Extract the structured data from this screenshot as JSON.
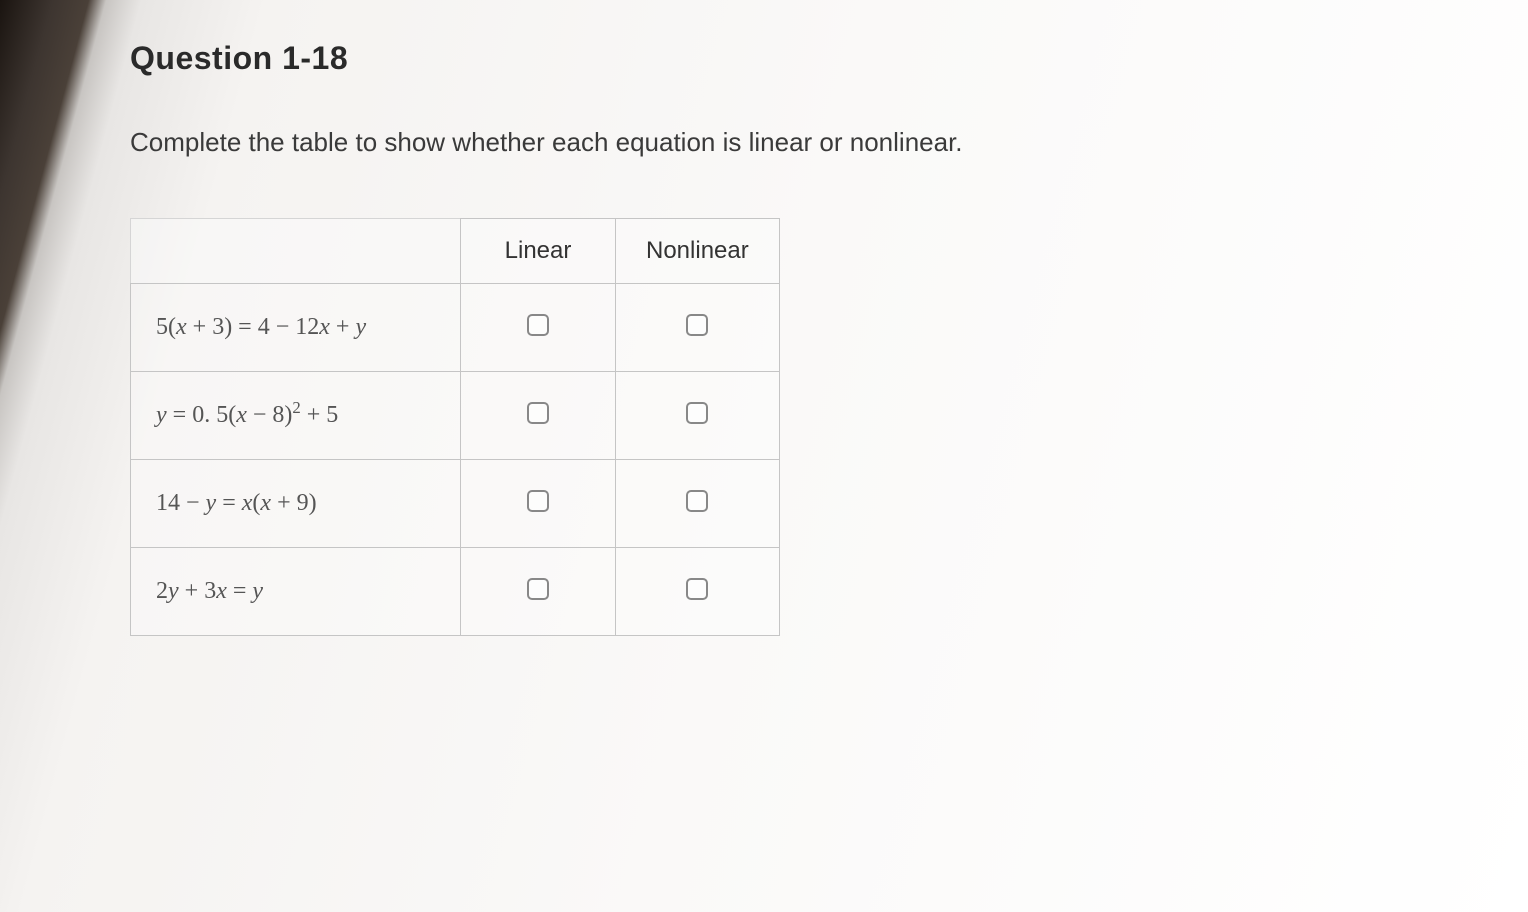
{
  "question": {
    "title": "Question 1-18",
    "instruction": "Complete the table to show whether each equation is linear or nonlinear."
  },
  "table": {
    "headers": {
      "col1": "",
      "col2": "Linear",
      "col3": "Nonlinear"
    },
    "rows": [
      {
        "equation_html": "5(<span class='math-italic'>x</span> + 3) = 4 − 12<span class='math-italic'>x</span> + <span class='math-italic'>y</span>"
      },
      {
        "equation_html": "<span class='math-italic'>y</span> = 0. 5(<span class='math-italic'>x</span> − 8)<sup>2</sup> + 5"
      },
      {
        "equation_html": "14 − <span class='math-italic'>y</span> = <span class='math-italic'>x</span>(<span class='math-italic'>x</span> + 9)"
      },
      {
        "equation_html": "2<span class='math-italic'>y</span> + 3<span class='math-italic'>x</span> = <span class='math-italic'>y</span>"
      }
    ]
  }
}
